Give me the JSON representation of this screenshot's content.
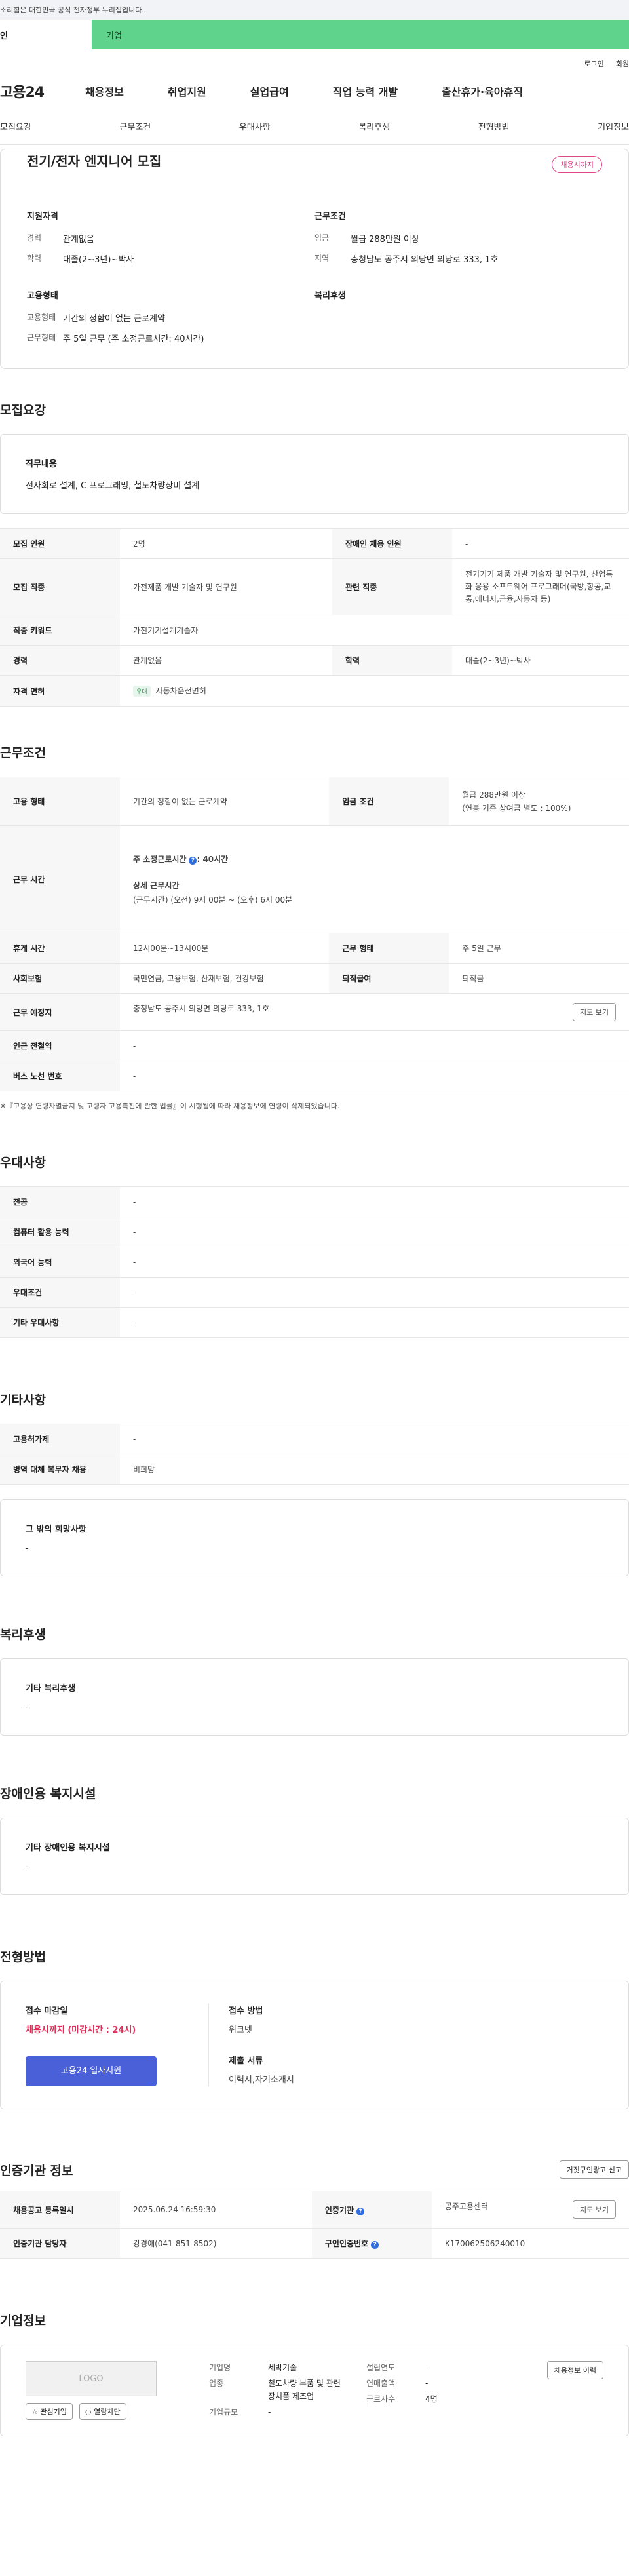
{
  "gov_notice": "소리힘은 대한민국 공식 전자정부 누리집입니다.",
  "user_tabs": {
    "personal": "인",
    "company": "기업"
  },
  "util": {
    "login": "로그인",
    "join": "회원"
  },
  "gnb": {
    "logo": "고용24",
    "menu": [
      "채용정보",
      "취업지원",
      "실업급여",
      "직업 능력 개발",
      "출산휴가·육아휴직"
    ]
  },
  "anchor_tabs": [
    "모집요강",
    "근무조건",
    "우대사항",
    "복리후생",
    "전형방법",
    "기업정보"
  ],
  "summary": {
    "title": "전기/전자 엔지니어 모집",
    "badge": "채용시까지",
    "qual_head": "지원자격",
    "cond_head": "근무조건",
    "type_head": "고용형태",
    "welfare_head": "복리후생",
    "qual": [
      {
        "k": "경력",
        "v": "관계없음"
      },
      {
        "k": "학력",
        "v": "대졸(2~3년)~박사"
      }
    ],
    "cond": [
      {
        "k": "임금",
        "v": "월급 288만원 이상"
      },
      {
        "k": "지역",
        "v": "충청남도 공주시 의당면 의당로 333, 1호"
      }
    ],
    "type": [
      {
        "k": "고용형태",
        "v": "기간의 정함이 없는 근로계약"
      },
      {
        "k": "근무형태",
        "v": "주 5일 근무 (주 소정근로시간: 40시간)"
      }
    ]
  },
  "recruit": {
    "heading": "모집요강",
    "duty_head": "직무내용",
    "duty": "전자회로 설계, C 프로그래밍, 철도차량장비 설계",
    "rows": [
      {
        "k1": "모집 인원",
        "v1": "2명",
        "k2": "장애인 채용 인원",
        "v2": "-"
      },
      {
        "k1": "모집 직종",
        "v1": "가전제품 개발 기술자 및 연구원",
        "k2": "관련 직종",
        "v2": "전기기기 제품 개발 기술자 및 연구원, 산업특화 응용 소프트웨어 프로그래머(국방,항공,교통,에너지,금융,자동차 등)"
      }
    ],
    "keyword": {
      "k": "직종 키워드",
      "v": "가전기기설계기술자"
    },
    "career": {
      "k1": "경력",
      "v1": "관계없음",
      "k2": "학력",
      "v2": "대졸(2~3년)~박사"
    },
    "license": {
      "k": "자격 면허",
      "tag": "우대",
      "v": "자동차운전면허"
    }
  },
  "cond": {
    "heading": "근무조건",
    "emp": {
      "k1": "고용 형태",
      "v1": "기간의 정함이 없는 근로계약",
      "k2": "임금 조건",
      "v2a": "월급 288만원 이상",
      "v2b": "(연봉 기준 상여금 별도 : 100%)"
    },
    "time": {
      "k": "근무 시간",
      "a": "주 소정근로시간",
      "a2": ": 40시간",
      "b": "상세 근무시간",
      "c": "(근무시간) (오전) 9시 00분 ~ (오후) 6시 00분"
    },
    "rest": {
      "k1": "휴게 시간",
      "v1": "12시00분~13시00분",
      "k2": "근무 형태",
      "v2": "주 5일 근무"
    },
    "ins": {
      "k1": "사회보험",
      "v1": "국민연금, 고용보험, 산재보험, 건강보험",
      "k2": "퇴직급여",
      "v2": "퇴직금"
    },
    "addr": {
      "k": "근무 예정지",
      "v": "충청남도 공주시 의당면 의당로 333, 1호",
      "btn": "지도 보기"
    },
    "subway": {
      "k": "인근 전철역",
      "v": "-"
    },
    "bus": {
      "k": "버스 노선 번호",
      "v": "-"
    },
    "note": "※『고용상 연령차별금지 및 고령자 고용촉진에 관한 법률』이 시행됨에 따라 채용정보에 연령이 삭제되었습니다."
  },
  "pref": {
    "heading": "우대사항",
    "rows": [
      {
        "k": "전공",
        "v": "-"
      },
      {
        "k": "컴퓨터 활용 능력",
        "v": "-"
      },
      {
        "k": "외국어 능력",
        "v": "-"
      },
      {
        "k": "우대조건",
        "v": "-"
      },
      {
        "k": "기타 우대사항",
        "v": "-"
      }
    ]
  },
  "etc": {
    "heading": "기타사항",
    "rows": [
      {
        "k": "고용허가제",
        "v": "-"
      },
      {
        "k": "병역 대체 복무자 채용",
        "v": "비희망"
      }
    ],
    "box_h": "그 밖의 희망사항",
    "box_v": "-"
  },
  "welfare": {
    "heading": "복리후생",
    "box_h": "기타 복리후생",
    "box_v": "-"
  },
  "disab": {
    "heading": "장애인용 복지시설",
    "box_h": "기타 장애인용 복지시설",
    "box_v": "-"
  },
  "process": {
    "heading": "전형방법",
    "deadline_h": "접수 마감일",
    "deadline_v": "채용시까지 (마감시간 : 24시)",
    "apply_btn": "고용24 입사지원",
    "method_h": "접수 방법",
    "method_v": "워크넷",
    "docs_h": "제출 서류",
    "docs_v": "이력서,자기소개서"
  },
  "agency": {
    "heading": "인증기관 정보",
    "report_btn": "거짓구인광고 신고",
    "r1": {
      "k1": "채용공고 등록일시",
      "v1": "2025.06.24 16:59:30",
      "k2": "인증기관",
      "v2": "공주고용센터",
      "btn": "지도 보기"
    },
    "r2": {
      "k1": "인증기관 담당자",
      "v1": "강경애(041-851-8502)",
      "k2": "구인인증번호",
      "v2": "K170062506240010"
    }
  },
  "company": {
    "heading": "기업정보",
    "logo": "LOGO",
    "fav": "관심기업",
    "block": "열람차단",
    "history_btn": "채용정보 이력",
    "name_k": "기업명",
    "name_v": "세박기술",
    "ind_k": "업종",
    "ind_v": "철도차량 부품 및 관련 장치품 제조업",
    "size_k": "기업규모",
    "size_v": "-",
    "year_k": "설립연도",
    "year_v": "-",
    "sales_k": "연매출액",
    "sales_v": "-",
    "emp_k": "근로자수",
    "emp_v": "4명"
  }
}
